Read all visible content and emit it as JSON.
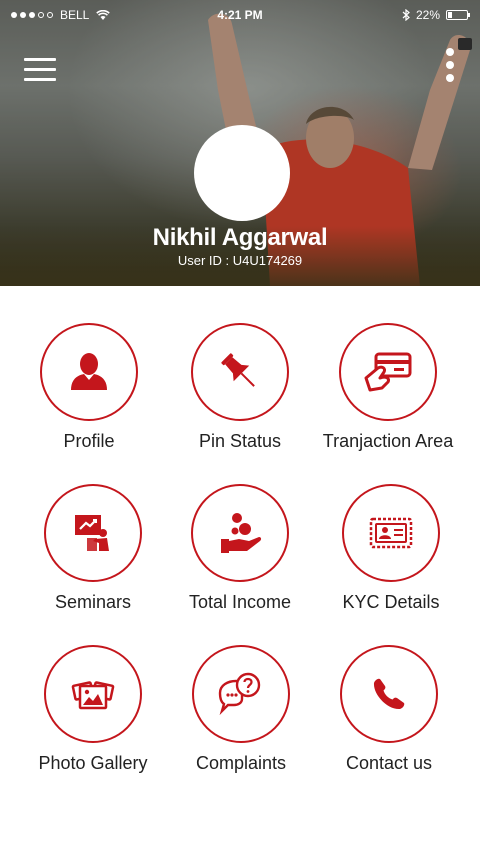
{
  "status_bar": {
    "carrier": "BELL",
    "time": "4:21 PM",
    "battery_text": "22%",
    "battery_level": 0.22,
    "signal_bars": 3
  },
  "header": {
    "menu_icon": "hamburger-icon",
    "more_icon": "more-vertical-icon",
    "user_name": "Nikhil Aggarwal",
    "user_id": "User ID : U4U174269"
  },
  "theme": {
    "accent": "#c4161c"
  },
  "grid": [
    {
      "label": "Profile",
      "icon": "user-icon"
    },
    {
      "label": "Pin Status",
      "icon": "pushpin-icon"
    },
    {
      "label": "Tranjaction Area",
      "icon": "card-payment-icon"
    },
    {
      "label": "Seminars",
      "icon": "presentation-icon"
    },
    {
      "label": "Total Income",
      "icon": "income-hand-icon"
    },
    {
      "label": "KYC Details",
      "icon": "id-card-icon"
    },
    {
      "label": "Photo Gallery",
      "icon": "gallery-icon"
    },
    {
      "label": "Complaints",
      "icon": "chat-question-icon"
    },
    {
      "label": "Contact us",
      "icon": "phone-icon"
    }
  ]
}
